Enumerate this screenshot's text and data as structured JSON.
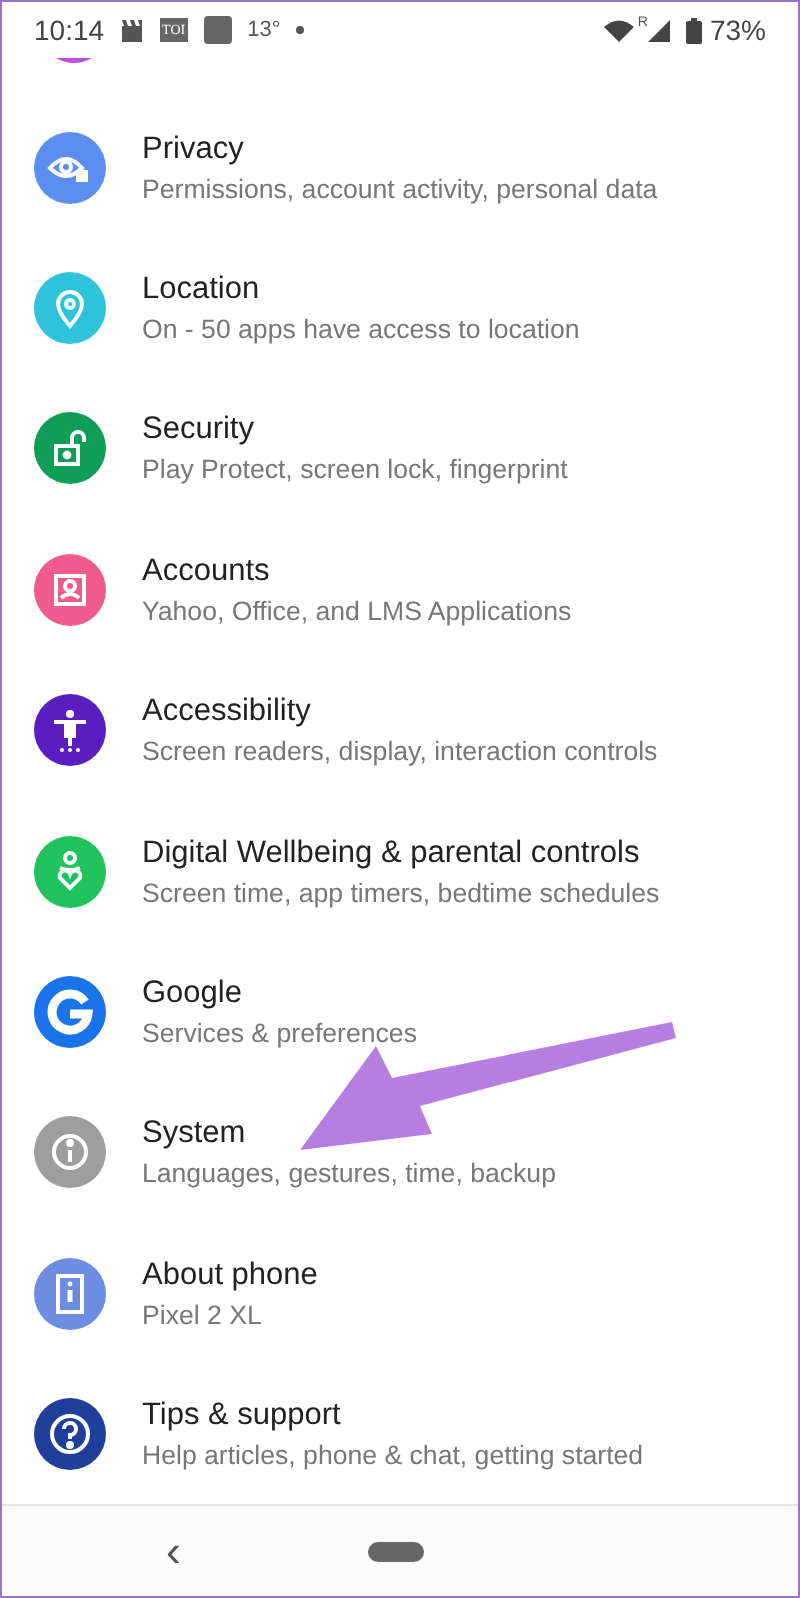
{
  "status_bar": {
    "time": "10:14",
    "news_badge": "TOI",
    "temperature": "13°",
    "roaming": "R",
    "battery": "73%"
  },
  "settings": [
    {
      "title": "Privacy",
      "subtitle": "Permissions, account activity, personal data",
      "color": "#5c8ef2"
    },
    {
      "title": "Location",
      "subtitle": "On - 50 apps have access to location",
      "color": "#2ec3db"
    },
    {
      "title": "Security",
      "subtitle": "Play Protect, screen lock, fingerprint",
      "color": "#0f9d58"
    },
    {
      "title": "Accounts",
      "subtitle": "Yahoo, Office, and LMS Applications",
      "color": "#ef5b8f"
    },
    {
      "title": "Accessibility",
      "subtitle": "Screen readers, display, interaction controls",
      "color": "#5a1ec0"
    },
    {
      "title": "Digital Wellbeing & parental controls",
      "subtitle": "Screen time, app timers, bedtime schedules",
      "color": "#1fc25c"
    },
    {
      "title": "Google",
      "subtitle": "Services & preferences",
      "color": "#1a73e8"
    },
    {
      "title": "System",
      "subtitle": "Languages, gestures, time, backup",
      "color": "#9e9e9e"
    },
    {
      "title": "About phone",
      "subtitle": "Pixel 2 XL",
      "color": "#6d8ee0"
    },
    {
      "title": "Tips & support",
      "subtitle": "Help articles, phone & chat, getting started",
      "color": "#203f9a"
    }
  ],
  "back_symbol": "‹"
}
